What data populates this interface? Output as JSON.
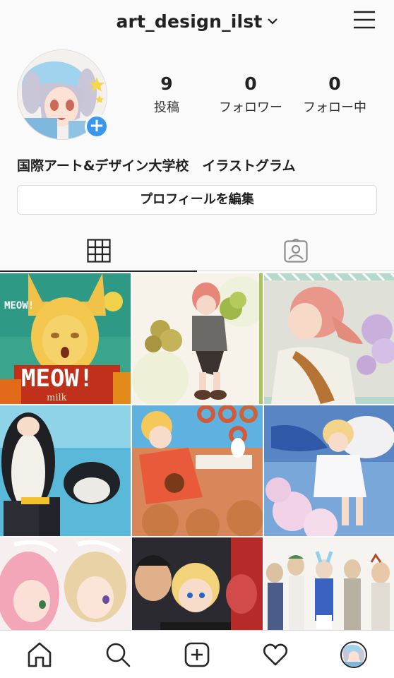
{
  "profile": {
    "username": "art_design_ilst",
    "full_name": "国際アート&デザイン大学校　イラストグラム",
    "edit_button": "プロフィールを編集"
  },
  "stats": {
    "posts": {
      "value": "9",
      "label": "投稿"
    },
    "followers": {
      "value": "0",
      "label": "フォロワー"
    },
    "following": {
      "value": "0",
      "label": "フォロー中"
    }
  },
  "tabs": [
    {
      "name": "grid-view",
      "icon": "grid-icon",
      "active": true
    },
    {
      "name": "tagged",
      "icon": "person-tag-icon",
      "active": false
    }
  ],
  "posts": [
    {
      "name": "meow-cat-girl",
      "text": "MEOW!",
      "text2": "milk"
    },
    {
      "name": "clover-boy"
    },
    {
      "name": "braided-girl"
    },
    {
      "name": "penguin-girl"
    },
    {
      "name": "donut-girl"
    },
    {
      "name": "angel-girl"
    },
    {
      "name": "maid-girls"
    },
    {
      "name": "boys-group"
    },
    {
      "name": "characters-lineup"
    }
  ],
  "nav": {
    "items": [
      "home-icon",
      "search-icon",
      "new-post-icon",
      "activity-heart-icon",
      "profile-avatar"
    ]
  },
  "colors": {
    "accent": "#3897f0",
    "text": "#262626",
    "border": "#dbdbdb"
  }
}
